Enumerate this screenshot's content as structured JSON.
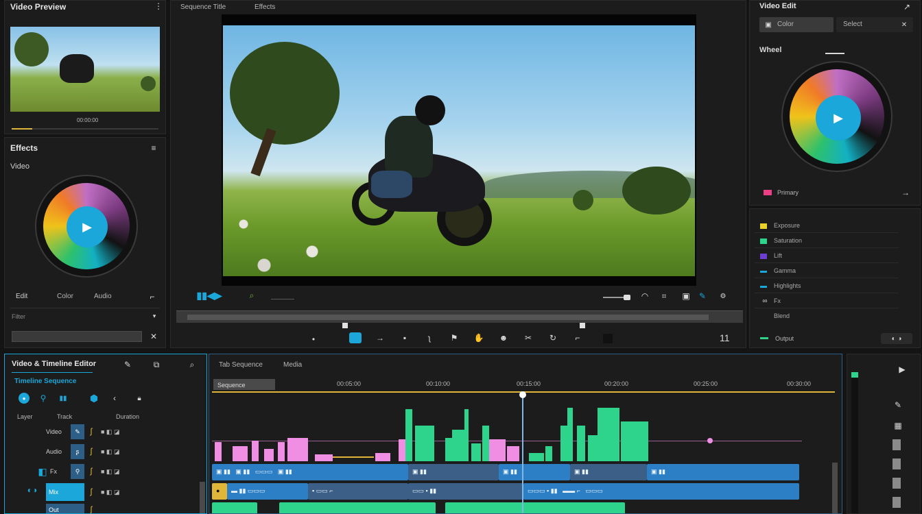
{
  "source_monitor": {
    "title": "Video Preview",
    "timecode": "00:00:00"
  },
  "effects_panel": {
    "title": "Effects",
    "subtitle": "Video",
    "tabs": [
      "Edit",
      "Color",
      "Audio"
    ],
    "search_placeholder": ""
  },
  "program_monitor": {
    "tabs": [
      "Sequence Title",
      "Effects"
    ],
    "scene_label": "Motorcycle rider on grassy meadow",
    "end_time": "11"
  },
  "inspector": {
    "title": "Video Edit",
    "tab_active": "Color",
    "tab_other": "Select",
    "section": "Wheel",
    "selected_label": "Primary",
    "items": [
      {
        "label": "Exposure",
        "color": "#e8d22a"
      },
      {
        "label": "Saturation",
        "color": "#2ed38c"
      },
      {
        "label": "Lift",
        "color": "#6c3fd0"
      },
      {
        "label": "Gamma",
        "color": "#1ba7d9"
      },
      {
        "label": "Highlights",
        "color": "#1ba7d9"
      },
      {
        "label": "Fx",
        "color": "#9a9a9a"
      },
      {
        "label": "Blend",
        "color": "#9a9a9a"
      }
    ],
    "footer_label": "Output"
  },
  "timeline": {
    "project_title": "Video & Timeline Editor",
    "sequence_label": "Timeline Sequence",
    "panel_tabs": [
      "Tab Sequence",
      "Media"
    ],
    "column_headers": [
      "Layer",
      "Track",
      "Duration"
    ],
    "track_labels": [
      "Video",
      "Audio",
      "Fx",
      "Mix",
      "Out"
    ],
    "ruler_current": "Sequence",
    "ruler_marks": [
      "00:05:00",
      "00:10:00",
      "00:15:00",
      "00:20:00",
      "00:25:00",
      "00:30:00"
    ]
  },
  "accent_colors": {
    "blue": "#1ba7d9",
    "green": "#2ed38c",
    "pink": "#ef8ee3",
    "playhead": "#f0a500"
  }
}
